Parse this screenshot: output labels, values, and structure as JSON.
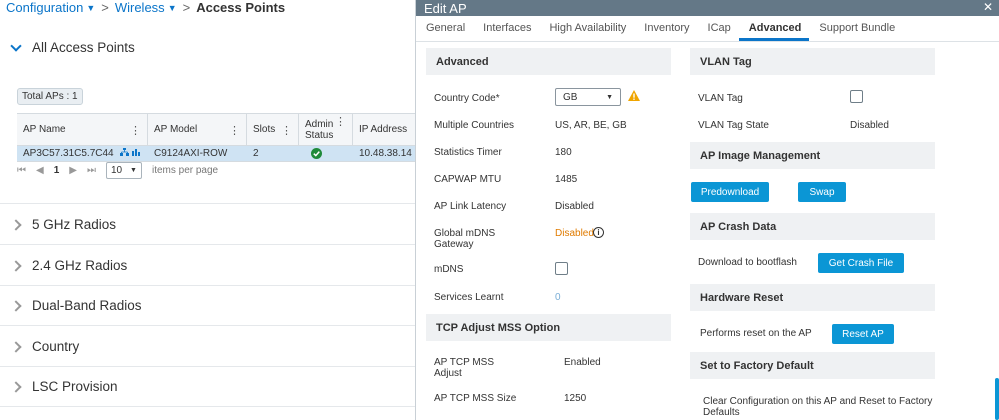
{
  "breadcrumb": {
    "items": [
      "Configuration",
      "Wireless"
    ],
    "current": "Access Points"
  },
  "all_aps": {
    "title": "All Access Points",
    "total": "Total APs : 1",
    "columns": [
      "AP Name",
      "AP Model",
      "Slots",
      "Admin Status",
      "IP Address"
    ],
    "row": {
      "ap_name": "AP3C57.31C5.7C44",
      "ap_model": "C9124AXI-ROW",
      "slots": "2",
      "ip": "10.48.38.14"
    },
    "pager": {
      "page": "1",
      "per_page": "10",
      "per_page_label": "items per page"
    }
  },
  "sections": [
    "5 GHz Radios",
    "2.4 GHz Radios",
    "Dual-Band Radios",
    "Country",
    "LSC Provision"
  ],
  "modal": {
    "title": "Edit AP",
    "tabs": [
      "General",
      "Interfaces",
      "High Availability",
      "Inventory",
      "ICap",
      "Advanced",
      "Support Bundle"
    ],
    "active_tab": "Advanced",
    "advanced": {
      "title": "Advanced",
      "country_code_label": "Country Code*",
      "country_code_value": "GB",
      "multiple_countries_label": "Multiple Countries",
      "multiple_countries_value": "US, AR, BE, GB",
      "statistics_timer_label": "Statistics Timer",
      "statistics_timer_value": "180",
      "capwap_mtu_label": "CAPWAP MTU",
      "capwap_mtu_value": "1485",
      "link_latency_label": "AP Link Latency",
      "link_latency_value": "Disabled",
      "mdns_gw_label_1": "Global mDNS",
      "mdns_gw_label_2": "Gateway",
      "mdns_gw_value": "Disabled",
      "mdns_label": "mDNS",
      "services_label": "Services Learnt",
      "services_value": "0"
    },
    "tcp": {
      "title": "TCP Adjust MSS Option",
      "adjust_label_1": "AP TCP MSS",
      "adjust_label_2": "Adjust",
      "adjust_value": "Enabled",
      "size_label": "AP TCP MSS Size",
      "size_value": "1250"
    },
    "vlan": {
      "title": "VLAN Tag",
      "tag_label": "VLAN Tag",
      "state_label": "VLAN Tag State",
      "state_value": "Disabled"
    },
    "image_mgmt": {
      "title": "AP Image Management",
      "predownload": "Predownload",
      "swap": "Swap"
    },
    "crash": {
      "title": "AP Crash Data",
      "label": "Download to bootflash",
      "button": "Get Crash File"
    },
    "hw_reset": {
      "title": "Hardware Reset",
      "label": "Performs reset on the AP",
      "button": "Reset AP"
    },
    "factory": {
      "title": "Set to Factory Default",
      "label_1": "Clear Configuration on this AP and Reset to Factory",
      "label_2": "Defaults"
    }
  },
  "colors": {
    "accent": "#0b75c9",
    "button": "#0b96d5",
    "header": "#647887",
    "warning": "#f0a500",
    "selected_row": "#cfe3f3"
  }
}
